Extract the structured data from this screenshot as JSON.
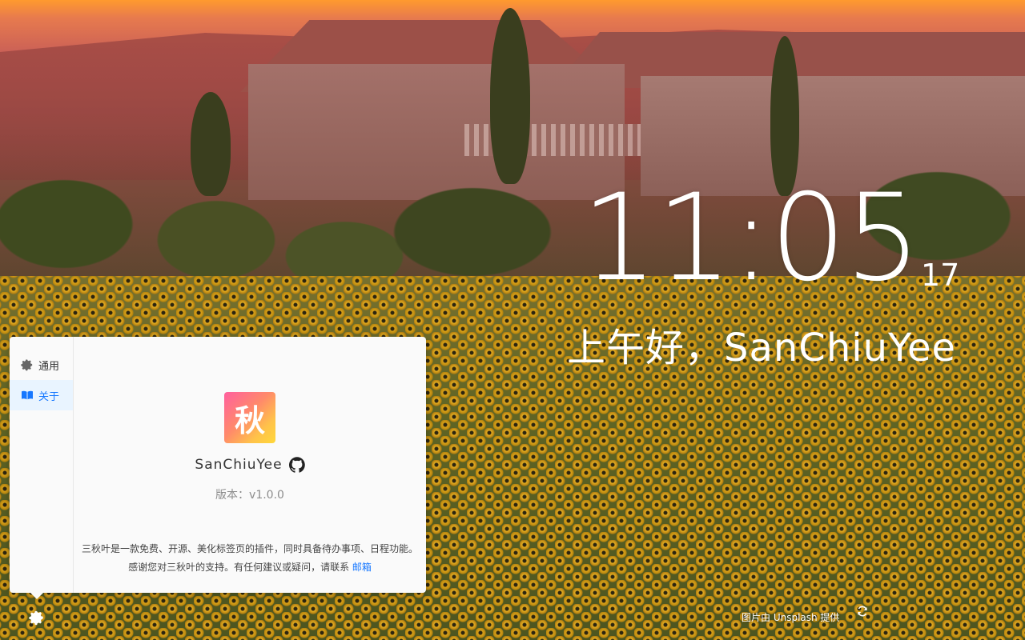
{
  "clock": {
    "time": "11:05",
    "seconds": "17"
  },
  "greeting": "上午好，SanChiuYee",
  "settings_panel": {
    "sidebar": [
      {
        "label": "通用",
        "icon": "gear-icon"
      },
      {
        "label": "关于",
        "icon": "book-icon"
      }
    ],
    "about": {
      "app_icon_char": "秋",
      "app_name": "SanChiuYee",
      "version": "版本：v1.0.0",
      "description_line1": "三秋叶是一款免费、开源、美化标签页的插件，同时具备待办事项、日程功能。",
      "description_line2": "感谢您对三秋叶的支持。有任何建议或疑问，请联系",
      "email_link": "邮箱"
    }
  },
  "footer": {
    "credit": "图片由 Unsplash 提供"
  },
  "colors": {
    "accent": "#1677ff",
    "panel_bg": "#fafafa"
  }
}
